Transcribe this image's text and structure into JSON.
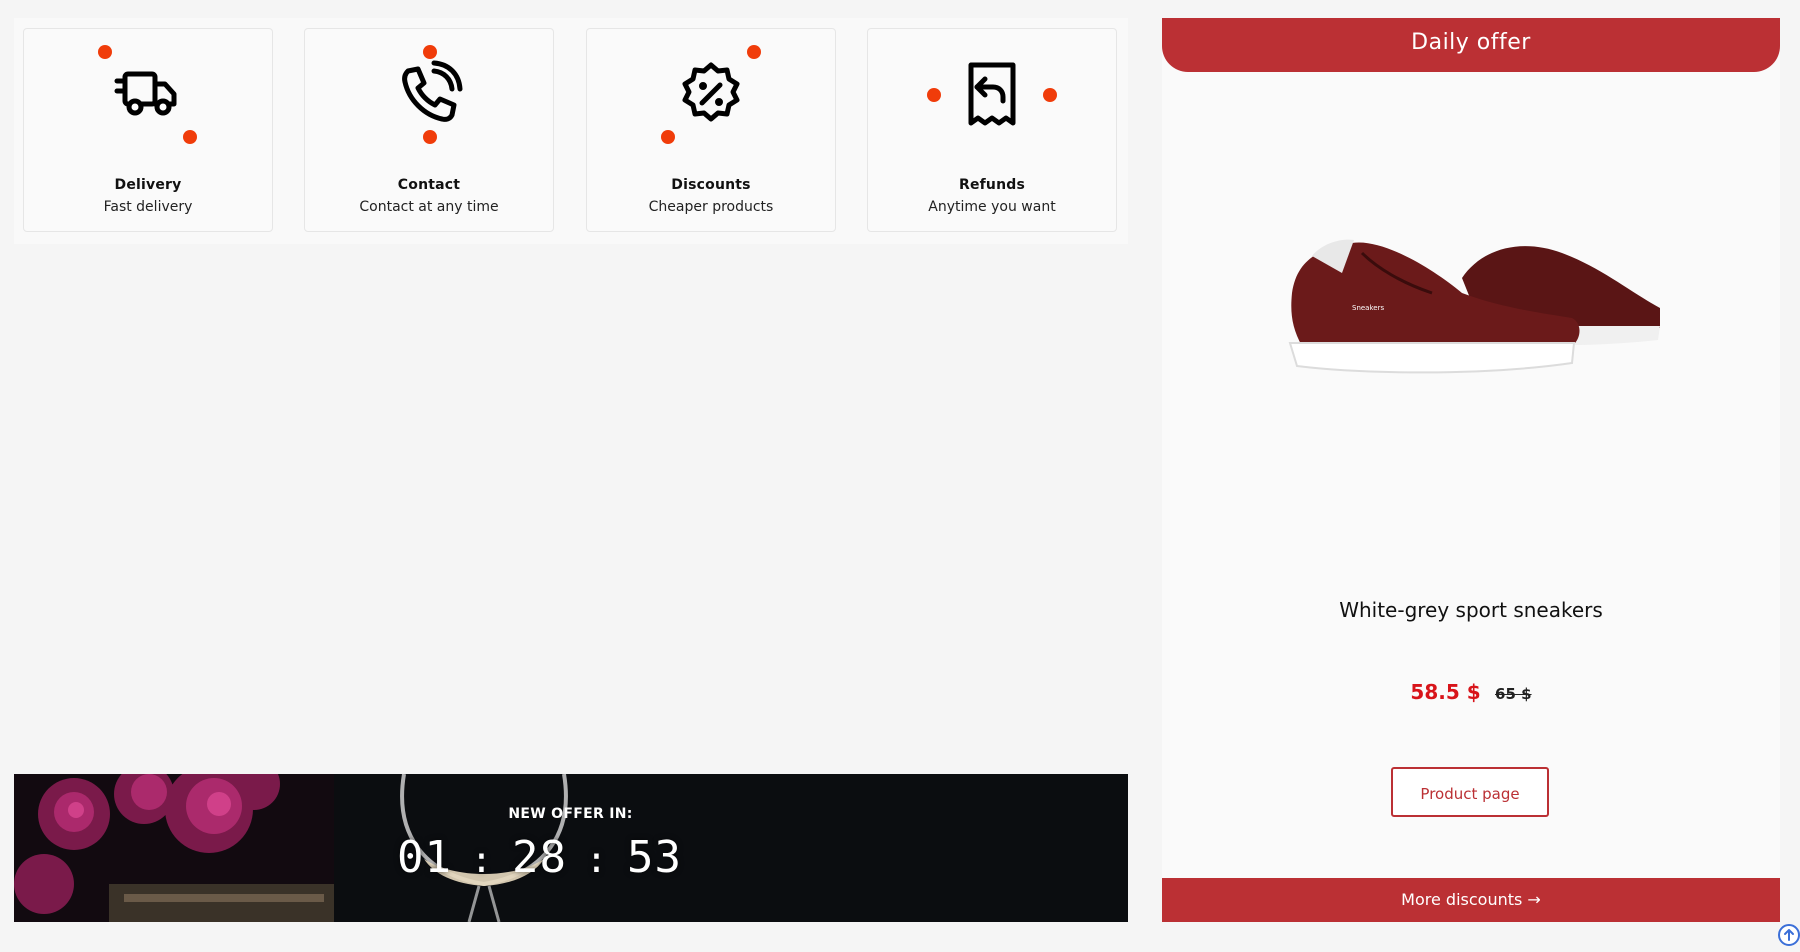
{
  "features": [
    {
      "title": "Delivery",
      "subtitle": "Fast delivery",
      "icon": "truck-icon"
    },
    {
      "title": "Contact",
      "subtitle": "Contact at any time",
      "icon": "phone-call-icon"
    },
    {
      "title": "Discounts",
      "subtitle": "Cheaper products",
      "icon": "discount-badge-icon"
    },
    {
      "title": "Refunds",
      "subtitle": "Anytime you want",
      "icon": "receipt-refund-icon"
    }
  ],
  "countdown": {
    "label": "NEW OFFER IN:",
    "hours": "01",
    "minutes": "28",
    "seconds": "53",
    "separator": ":"
  },
  "daily_offer": {
    "header": "Daily offer",
    "product_name": "White-grey sport sneakers",
    "price_new": "58.5 $",
    "price_old": "65 $",
    "product_button": "Product page",
    "more_discounts": "More discounts →"
  },
  "colors": {
    "accent": "#bb3034",
    "dot": "#f03c0a",
    "price": "#d8141a"
  }
}
